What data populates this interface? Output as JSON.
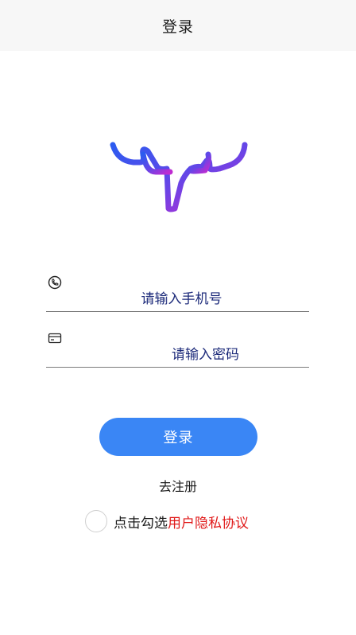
{
  "header": {
    "title": "登录"
  },
  "form": {
    "phone": {
      "placeholder": "请输入手机号",
      "value": "",
      "icon": "phone-icon"
    },
    "password": {
      "placeholder": "请输入密码",
      "value": "",
      "icon": "card-icon"
    }
  },
  "actions": {
    "login_label": "登录",
    "register_label": "去注册"
  },
  "agreement": {
    "prefix": "点击勾选",
    "link": "用户隐私协议",
    "checked": false
  },
  "colors": {
    "primary": "#3a86f5",
    "link": "#e01818",
    "header_bg": "#f7f7f7",
    "logo_gradient": [
      "#2b5bf0",
      "#7a3fe0",
      "#c02bd0"
    ]
  }
}
